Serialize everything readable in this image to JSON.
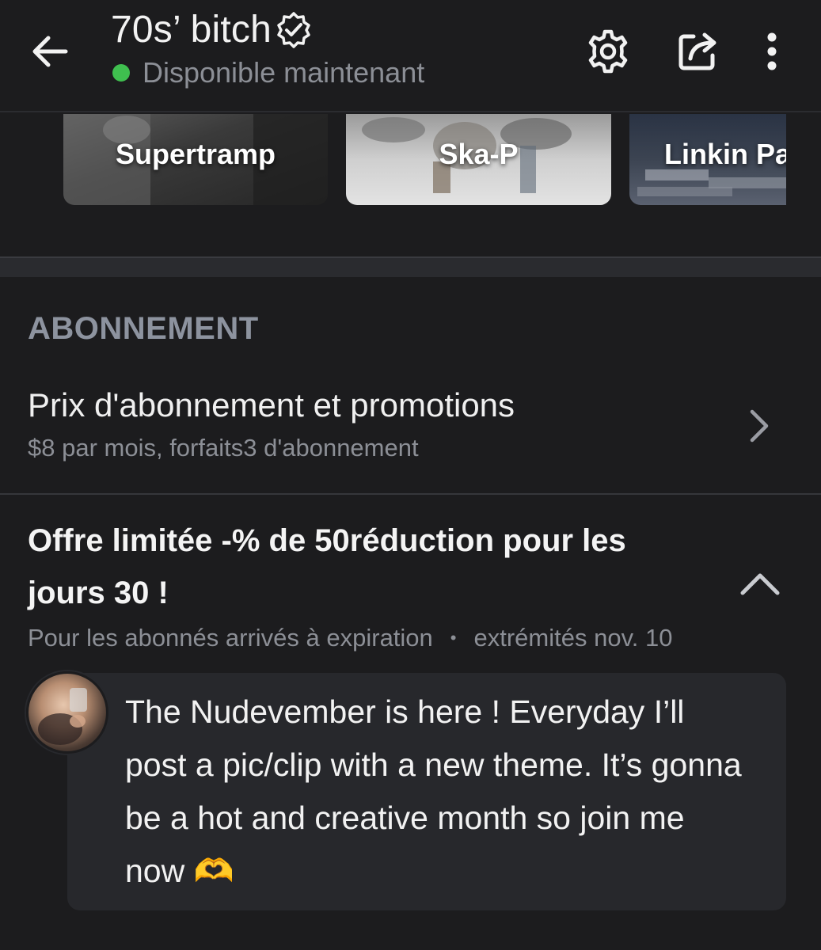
{
  "header": {
    "title": "70s’ bitch",
    "status": "Disponible maintenant"
  },
  "playlists": [
    {
      "label": "Supertramp"
    },
    {
      "label": "Ska-P"
    },
    {
      "label": "Linkin Pa"
    }
  ],
  "subscription": {
    "section_label": "ABONNEMENT",
    "title": "Prix d'abonnement et promotions",
    "subtitle": "$8 par mois, forfaits3 d'abonnement"
  },
  "offer": {
    "title": "Offre limitée -% de 50réduction pour les jours 30 !",
    "audience": "Pour les abonnés arrivés à expiration",
    "separator": "•",
    "ends": "extrémités nov. 10",
    "message": "The Nudevember is here ! Everyday I’ll post a pic/clip with a new theme. It’s gonna be a hot and creative month so join me now 🫶"
  },
  "colors": {
    "background": "#1c1c1e",
    "status_online": "#3fbf4f",
    "muted_text": "#8c8f96",
    "section_label": "#8d939f",
    "bubble": "#27282c"
  },
  "icons": [
    "back-arrow-icon",
    "verified-badge-icon",
    "gear-icon",
    "share-icon",
    "more-vertical-icon",
    "chevron-right-icon",
    "chevron-up-icon"
  ]
}
